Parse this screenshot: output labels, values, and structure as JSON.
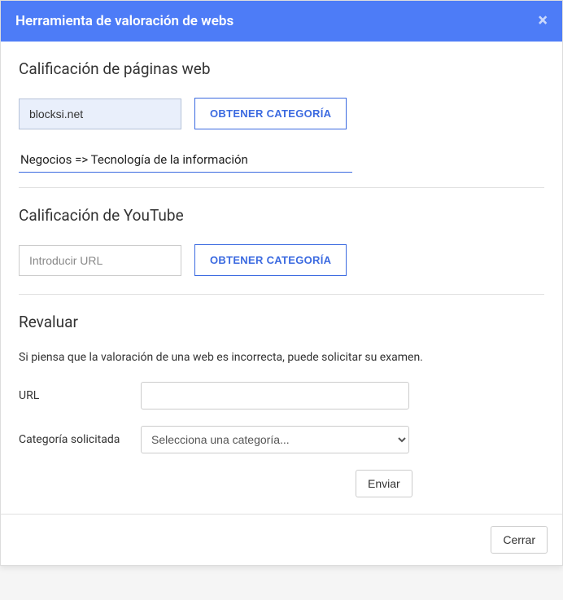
{
  "header": {
    "title": "Herramienta de valoración de webs"
  },
  "webRating": {
    "title": "Calificación de páginas web",
    "input_value": "blocksi.net",
    "button_label": "OBTENER CATEGORÍA",
    "result": "Negocios => Tecnología de la información"
  },
  "youtubeRating": {
    "title": "Calificación de YouTube",
    "input_placeholder": "Introducir URL",
    "button_label": "OBTENER CATEGORÍA"
  },
  "revaluate": {
    "title": "Revaluar",
    "help_text": "Si piensa que la valoración de una web es incorrecta, puede solicitar su examen.",
    "url_label": "URL",
    "category_label": "Categoría solicitada",
    "category_placeholder": "Selecciona una categoría...",
    "submit_label": "Enviar"
  },
  "footer": {
    "close_label": "Cerrar"
  }
}
